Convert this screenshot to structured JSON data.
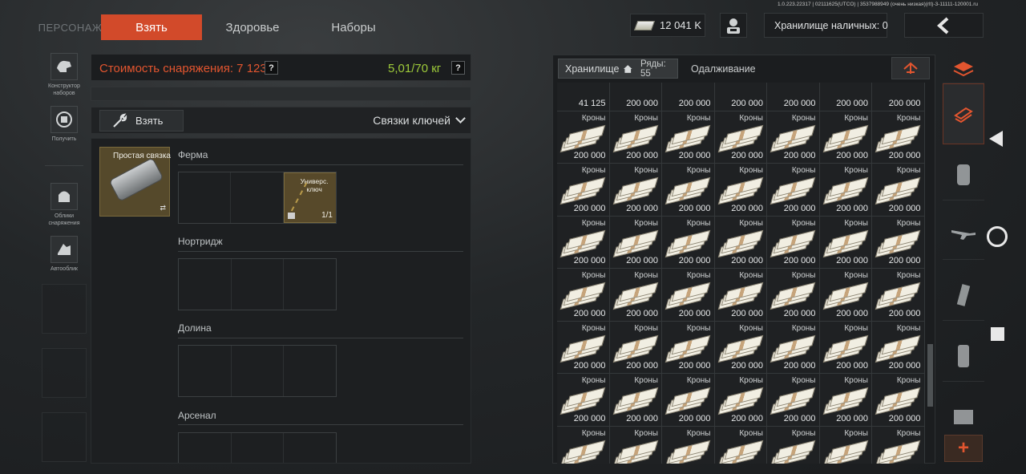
{
  "build_info": "1.0.223.22317 | 02111625(UTCO) | 3537988949 (очень низкая)(rlt)-3-11111-120001.ru",
  "tabs": {
    "character": "ПЕРСОНАЖ",
    "take": "Взять",
    "health": "Здоровье",
    "kits": "Наборы"
  },
  "header": {
    "money": "12 041 K",
    "cash_storage": "Хранилище наличных: 0"
  },
  "left_rail": {
    "items": [
      {
        "label": "Конструктор наборов",
        "icon": "kit-builder-icon"
      },
      {
        "label": "Получить",
        "icon": "receive-icon"
      },
      {
        "label": "Облики снаряжения",
        "icon": "gear-skins-icon"
      },
      {
        "label": "Автооблик",
        "icon": "auto-skin-icon"
      }
    ]
  },
  "gear": {
    "cost_label": "Стоимость снаряжения: 7 123",
    "weight": "5,01/70 кг",
    "help": "?"
  },
  "take_row": {
    "take_label": "Взять",
    "filter": "Связки ключей"
  },
  "keychain": {
    "label": "Простая связка",
    "sections": [
      {
        "title": "Ферма"
      },
      {
        "title": "Нортридж"
      },
      {
        "title": "Долина"
      },
      {
        "title": "Арсенал"
      }
    ],
    "key_item": {
      "label_line1": "Универс.",
      "label_line2": "ключ",
      "count": "1/1"
    }
  },
  "storage": {
    "tab_label": "Хранилище",
    "rows_label": "Ряды: 55",
    "borrow_label": "Одалживание",
    "top_row": [
      "41 125",
      "200 000",
      "200 000",
      "200 000",
      "200 000",
      "200 000",
      "200 000"
    ],
    "cell_label": "Кроны",
    "cell_amount": "200 000"
  },
  "colors": {
    "accent": "#d24a2a",
    "cost_text": "#e2552f",
    "weight_text": "#9ecb3a"
  }
}
